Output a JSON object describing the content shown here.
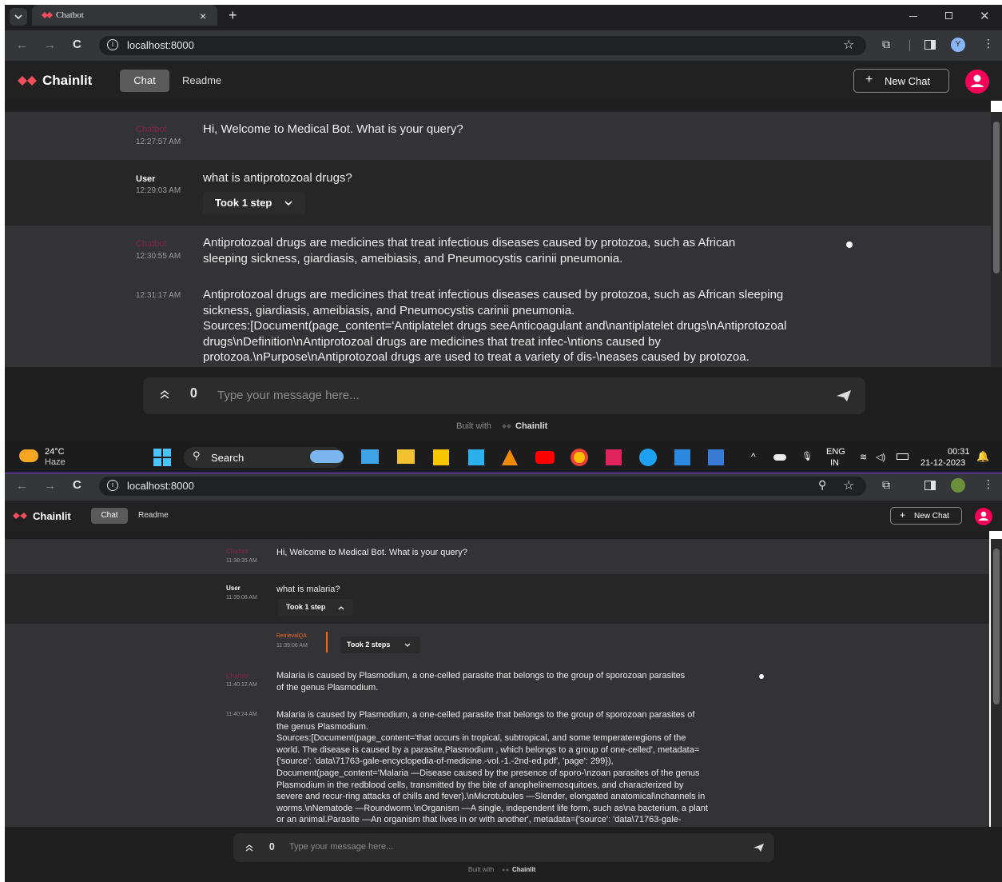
{
  "browser": {
    "tab_title": "Chatbot",
    "tab_close": "×",
    "new_tab": "+",
    "url": "localhost:8000",
    "profile_initial": "Y"
  },
  "app": {
    "logo": "Chainlit",
    "nav": [
      {
        "label": "Chat"
      },
      {
        "label": "Readme"
      }
    ],
    "new_chat": "New Chat",
    "composer_placeholder": "Type your message here...",
    "built_with": "Built with",
    "built_with_brand": "Chainlit"
  },
  "thread1": {
    "messages": [
      {
        "author": "Chatbot",
        "time": "12:27:57 AM",
        "text": "Hi, Welcome to Medical Bot. What is your query?"
      },
      {
        "author": "User",
        "time": "12:29:03 AM",
        "text": "what is antiprotozoal drugs?",
        "step_label": "Took 1 step"
      },
      {
        "author": "Chatbot",
        "time": "12:30:55 AM",
        "lines": [
          "Antiprotozoal drugs are medicines that treat infectious diseases caused by protozoa, such as African",
          "sleeping sickness, giardiasis, ameibiasis, and Pneumocystis carinii pneumonia."
        ]
      },
      {
        "author": "",
        "time": "12:31:17 AM",
        "lines": [
          "Antiprotozoal drugs are medicines that treat infectious diseases caused by protozoa, such as African sleeping",
          "sickness, giardiasis, ameibiasis, and Pneumocystis carinii pneumonia.",
          "Sources:[Document(page_content='Antiplatelet drugs seeAnticoagulant and\\nantiplatelet drugs\\nAntiprotozoal",
          "drugs\\nDefinition\\nAntiprotozoal drugs are medicines that treat infec-\\ntions caused by",
          "protozoa.\\nPurpose\\nAntiprotozoal drugs are used to treat a variety of dis-\\neases caused by protozoa."
        ]
      }
    ]
  },
  "taskbar": {
    "temp": "24°C",
    "weather": "Haze",
    "search": "Search",
    "lang_top": "ENG",
    "lang_bottom": "IN",
    "time": "00:31",
    "date": "21-12-2023"
  },
  "thread2": {
    "messages": [
      {
        "author": "Chatbot",
        "time": "11:38:35 AM",
        "text": "Hi, Welcome to Medical Bot. What is your query?"
      },
      {
        "author": "User",
        "time": "11:39:06 AM",
        "text": "what is malaria?",
        "step_label": "Took 1 step"
      },
      {
        "author": "RetrievalQA",
        "time": "11:39:06 AM",
        "step_label": "Took 2 steps"
      },
      {
        "author": "Chatbot",
        "time": "11:40:12 AM",
        "lines": [
          "Malaria is caused by Plasmodium, a one-celled parasite that belongs to the group of sporozoan parasites",
          "of the genus Plasmodium."
        ]
      },
      {
        "author": "",
        "time": "11:40:24 AM",
        "lines": [
          "Malaria is caused by Plasmodium, a one-celled parasite that belongs to the group of sporozoan parasites of",
          "the genus Plasmodium.",
          "Sources:[Document(page_content='that occurs in tropical, subtropical, and some temperateregions of the",
          "world. The disease is caused by a parasite,Plasmodium , which belongs to a group of one-celled', metadata=",
          "{'source': 'data\\71763-gale-encyclopedia-of-medicine.-vol.-1.-2nd-ed.pdf', 'page': 299}),",
          "Document(page_content='Malaria —Disease caused by the presence of sporo-\\nzoan parasites of the genus",
          "Plasmodium in the redblood cells, transmitted by the bite of anophelinemosquitoes, and characterized by",
          "severe and recur-ring attacks of chills and fever).\\nMicrotubules —Slender, elongated anatomical\\nchannels in",
          "worms.\\nNematode —Roundworm.\\nOrganism —A single, independent life form, such as\\na bacterium, a plant",
          "or an animal.Parasite —An organism that lives in or with another', metadata={'source': 'data\\71763-gale-"
        ]
      }
    ]
  }
}
